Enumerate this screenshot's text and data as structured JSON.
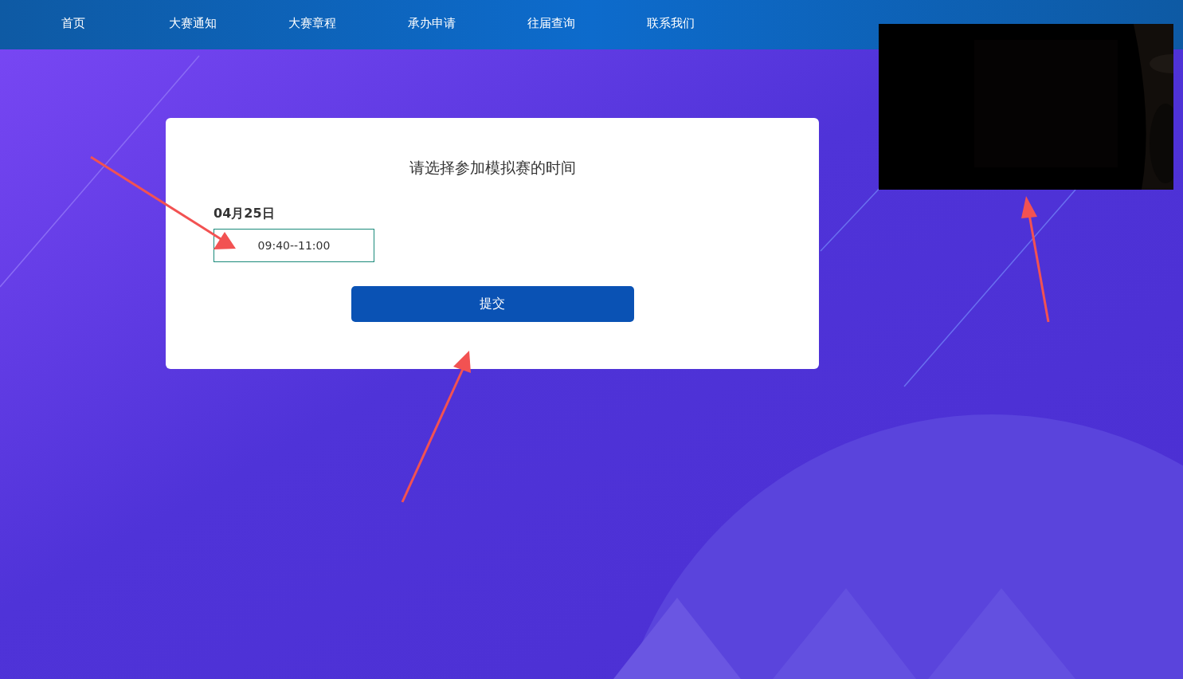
{
  "nav": {
    "items": [
      {
        "label": "首页"
      },
      {
        "label": "大赛通知"
      },
      {
        "label": "大赛章程"
      },
      {
        "label": "承办申请"
      },
      {
        "label": "往届查询"
      },
      {
        "label": "联系我们"
      }
    ]
  },
  "form": {
    "title": "请选择参加模拟赛的时间",
    "days": [
      {
        "date": "04月25日",
        "slots": [
          {
            "label": "09:40--11:00"
          }
        ]
      }
    ],
    "submit": "提交"
  }
}
